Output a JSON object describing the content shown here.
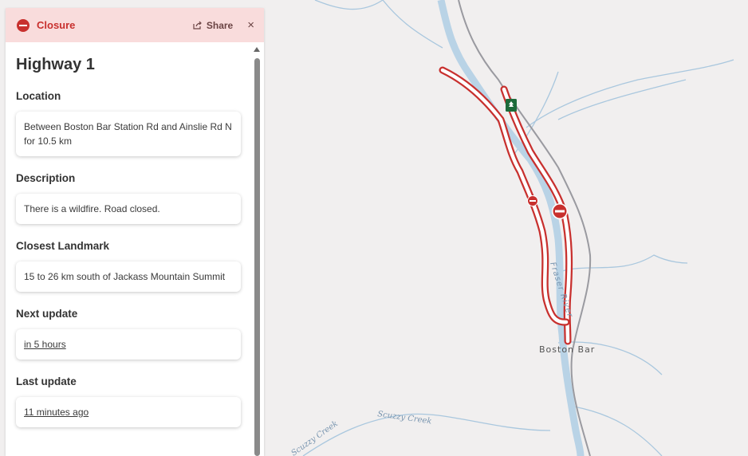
{
  "panel": {
    "header": {
      "title": "Closure",
      "share_label": "Share",
      "close_label": "×"
    },
    "title": "Highway 1",
    "sections": {
      "location": {
        "label": "Location",
        "value": "Between Boston Bar Station Rd and Ainslie Rd N for 10.5 km"
      },
      "description": {
        "label": "Description",
        "value": "There is a wildfire. Road closed."
      },
      "landmark": {
        "label": "Closest Landmark",
        "value": "15 to 26 km south of Jackass Mountain Summit"
      },
      "next_update": {
        "label": "Next update",
        "value": "in 5 hours"
      },
      "last_update": {
        "label": "Last update",
        "value": "11 minutes ago"
      }
    }
  },
  "map": {
    "labels": {
      "town": "Boston Bar",
      "river": "Fraser River",
      "creek_1": "Scuzzy Creek",
      "creek_2": "Scuzzy Creek"
    },
    "colors": {
      "closure": "#c8302e",
      "water": "#b9d3e6",
      "highway_marker": "#1d6b3a"
    },
    "icons": [
      "closure-icon",
      "highway-shield-icon"
    ]
  }
}
